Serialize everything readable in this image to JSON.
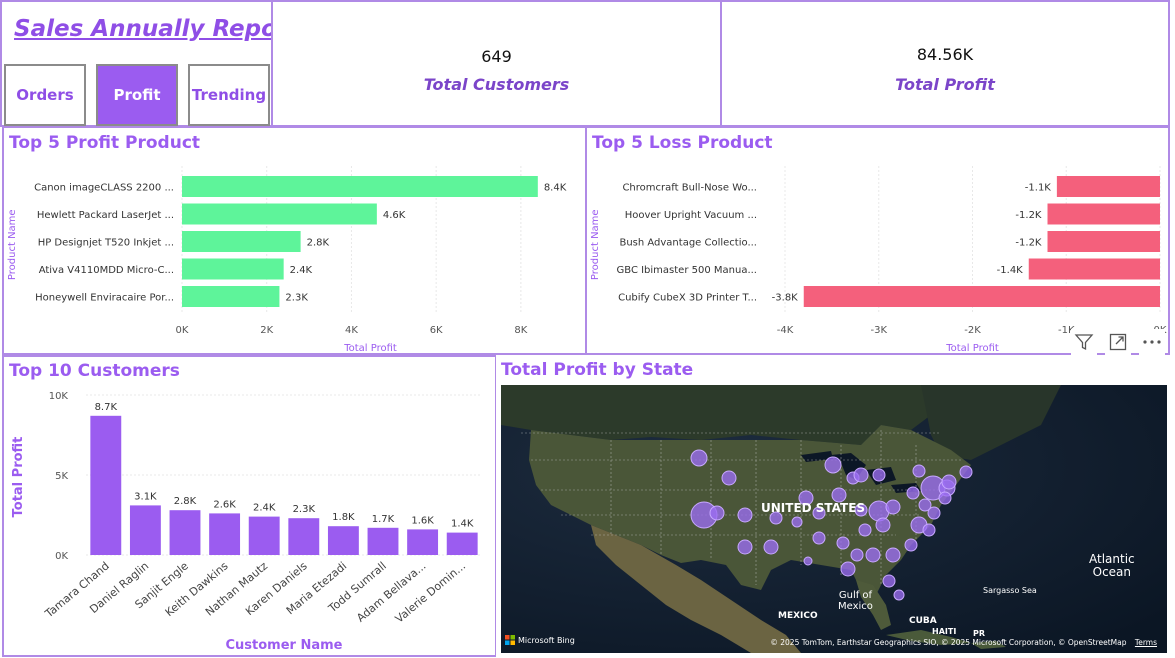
{
  "header": {
    "title": "Sales Annually Report",
    "nav": [
      {
        "label": "Orders",
        "active": false
      },
      {
        "label": "Profit",
        "active": true
      },
      {
        "label": "Trending",
        "active": false
      }
    ]
  },
  "kpis": [
    {
      "value": "649",
      "label": "Total Customers"
    },
    {
      "value": "84.56K",
      "label": "Total Profit"
    }
  ],
  "visuals": {
    "profit_title": "Top 5 Profit Product",
    "loss_title": "Top 5 Loss Product",
    "customers_title": "Top 10 Customers",
    "map_title": "Total Profit by State"
  },
  "colors": {
    "accent": "#9b5cf0",
    "profit_bar": "#5ef49a",
    "loss_bar": "#f4607c",
    "border": "#b08ae6"
  },
  "visual_toolbar": [
    "filter-icon",
    "focus-mode-icon",
    "more-options-icon"
  ],
  "map": {
    "labels": [
      "UNITED STATES",
      "MEXICO",
      "CUBA",
      "HAITI",
      "PR",
      "Gulf of",
      "Mexico",
      "Atlantic",
      "Ocean",
      "Sargasso Sea"
    ],
    "attribution": "© 2025 TomTom, Earthstar Geographics SIO, © 2025 Microsoft Corporation, © OpenStreetMap",
    "terms": "Terms",
    "bing": "Microsoft Bing"
  },
  "chart_data": [
    {
      "type": "bar",
      "orientation": "horizontal",
      "title": "Top 5 Profit Product",
      "xlabel": "Total Profit",
      "ylabel": "Product Name",
      "categories": [
        "Canon imageCLASS 2200 ...",
        "Hewlett Packard LaserJet ...",
        "HP Designjet T520 Inkjet ...",
        "Ativa V4110MDD Micro-C...",
        "Honeywell Enviracaire Por..."
      ],
      "values": [
        8400,
        4600,
        2800,
        2400,
        2300
      ],
      "data_labels": [
        "8.4K",
        "4.6K",
        "2.8K",
        "2.4K",
        "2.3K"
      ],
      "ticks": [
        0,
        2000,
        4000,
        6000,
        8000
      ],
      "tick_labels": [
        "0K",
        "2K",
        "4K",
        "6K",
        "8K"
      ],
      "xlim": [
        0,
        8900
      ]
    },
    {
      "type": "bar",
      "orientation": "horizontal",
      "title": "Top 5 Loss Product",
      "xlabel": "Total Profit",
      "ylabel": "Product Name",
      "categories": [
        "Chromcraft Bull-Nose Wo...",
        "Hoover Upright Vacuum ...",
        "Bush Advantage Collectio...",
        "GBC Ibimaster 500 Manua...",
        "Cubify CubeX 3D Printer T..."
      ],
      "values": [
        -1100,
        -1200,
        -1200,
        -1400,
        -3800
      ],
      "data_labels": [
        "-1.1K",
        "-1.2K",
        "-1.2K",
        "-1.4K",
        "-3.8K"
      ],
      "ticks": [
        -4000,
        -3000,
        -2000,
        -1000,
        0
      ],
      "tick_labels": [
        "-4K",
        "-3K",
        "-2K",
        "-1K",
        "0K"
      ],
      "xlim": [
        -4000,
        0
      ]
    },
    {
      "type": "bar",
      "title": "Top 10 Customers",
      "xlabel": "Customer Name",
      "ylabel": "Total Profit",
      "categories": [
        "Tamara Chand",
        "Daniel Raglin",
        "Sanjit Engle",
        "Keith Dawkins",
        "Nathan Mautz",
        "Karen Daniels",
        "Maria Etezadi",
        "Todd Sumrall",
        "Adam Bellava...",
        "Valerie Domin..."
      ],
      "values": [
        8700,
        3100,
        2800,
        2600,
        2400,
        2300,
        1800,
        1700,
        1600,
        1400
      ],
      "data_labels": [
        "8.7K",
        "3.1K",
        "2.8K",
        "2.6K",
        "2.4K",
        "2.3K",
        "1.8K",
        "1.7K",
        "1.6K",
        "1.4K"
      ],
      "ticks": [
        0,
        5000,
        10000
      ],
      "tick_labels": [
        "0K",
        "5K",
        "10K"
      ],
      "ylim": [
        0,
        10000
      ]
    }
  ]
}
